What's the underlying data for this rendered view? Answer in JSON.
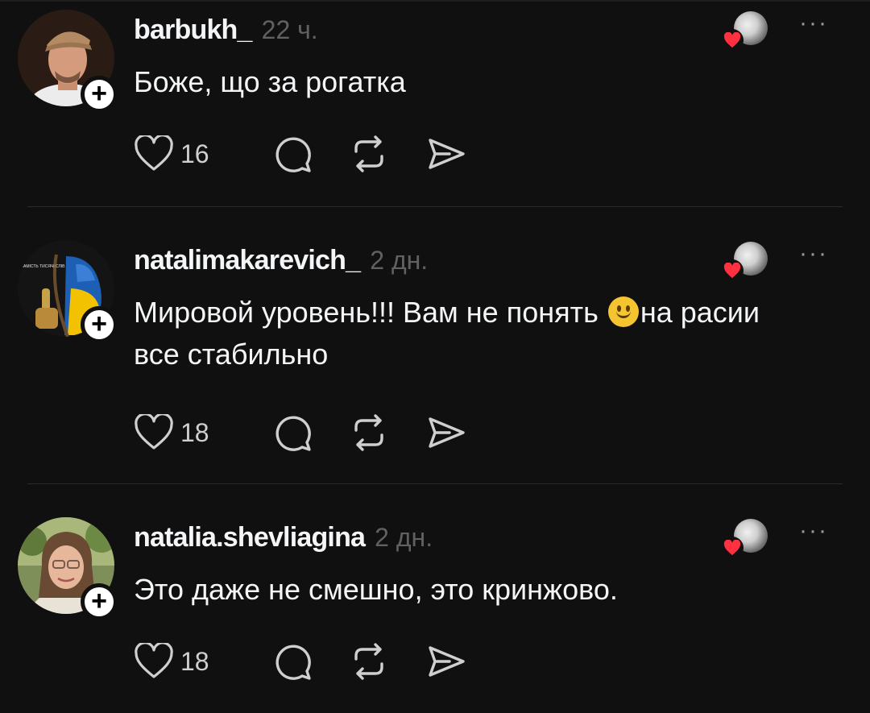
{
  "posts": [
    {
      "username": "barbukh_",
      "time": "22 ч.",
      "text": "Боже, що за рогатка",
      "text_after_emoji": "",
      "likes": "16"
    },
    {
      "username": "natalimakarevich_",
      "time": "2 дн.",
      "text": "Мировой уровень!!! Вам не понять ",
      "text_after_emoji": "на расии все стабильно",
      "likes": "18",
      "avatar_caption": "ЗАМІСТЬ ТИСЯЧІ СЛІВ"
    },
    {
      "username": "natalia.shevliagina",
      "time": "2 дн.",
      "text": "Это даже не смешно, это кринжово.",
      "text_after_emoji": "",
      "likes": "18"
    }
  ],
  "icons": {
    "like": "heart-outline-icon",
    "comment": "comment-bubble-icon",
    "repost": "repost-arrows-icon",
    "share": "send-paper-plane-icon",
    "more": "more-dots-icon",
    "follow": "plus-icon",
    "liked_by_author": "red-heart-icon"
  },
  "colors": {
    "background": "#101010",
    "text": "#f3f5f7",
    "secondary": "#616161",
    "heart": "#ff3040",
    "divider": "#2a2a2a"
  }
}
